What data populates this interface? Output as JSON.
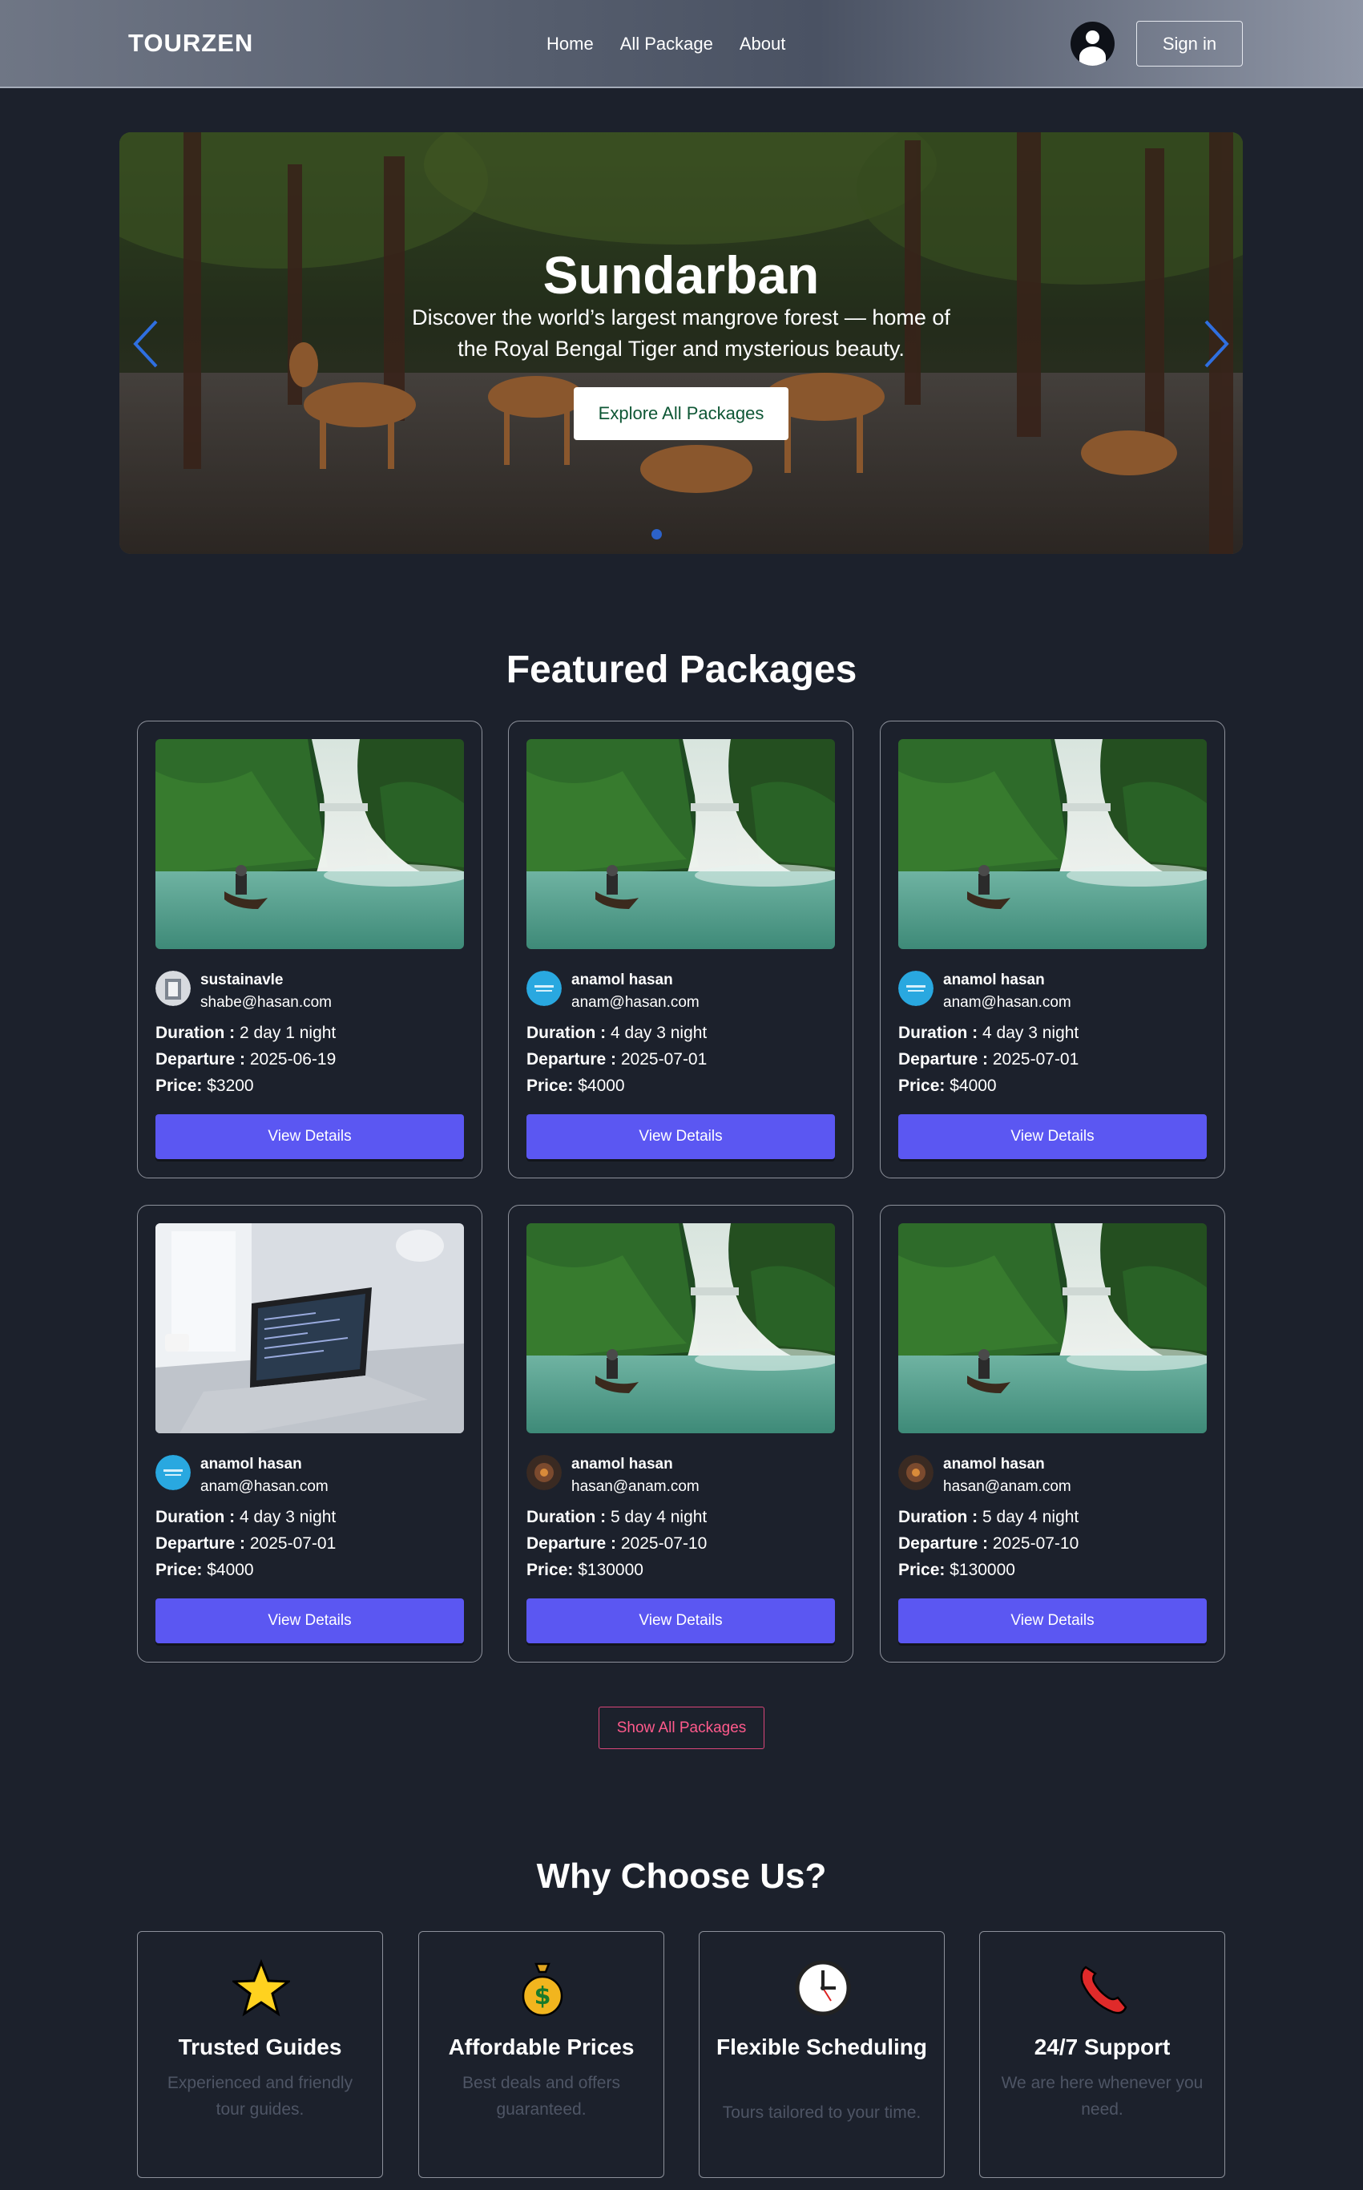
{
  "navbar": {
    "logo": "TOURZEN",
    "links": [
      "Home",
      "All Package",
      "About"
    ],
    "signin_label": "Sign in"
  },
  "hero": {
    "title": "Sundarban",
    "description": "Discover the world’s largest mangrove forest — home of the Royal Bengal Tiger and mysterious beauty.",
    "button_label": "Explore All Packages"
  },
  "featured": {
    "title": "Featured Packages",
    "labels": {
      "duration": "Duration :",
      "departure": "Departure :",
      "price": "Price:"
    },
    "button_label": "View Details",
    "packages": [
      {
        "name": "sustainavle",
        "email": "shabe@hasan.com",
        "duration": "2 day 1 night",
        "departure": "2025-06-19",
        "price": "$3200",
        "image": "waterfall",
        "avatar": "gray"
      },
      {
        "name": "anamol hasan",
        "email": "anam@hasan.com",
        "duration": "4 day 3 night",
        "departure": "2025-07-01",
        "price": "$4000",
        "image": "waterfall",
        "avatar": "blue"
      },
      {
        "name": "anamol hasan",
        "email": "anam@hasan.com",
        "duration": "4 day 3 night",
        "departure": "2025-07-01",
        "price": "$4000",
        "image": "waterfall",
        "avatar": "blue"
      },
      {
        "name": "anamol hasan",
        "email": "anam@hasan.com",
        "duration": "4 day 3 night",
        "departure": "2025-07-01",
        "price": "$4000",
        "image": "laptop",
        "avatar": "blue"
      },
      {
        "name": "anamol hasan",
        "email": "hasan@anam.com",
        "duration": "5 day 4 night",
        "departure": "2025-07-10",
        "price": "$130000",
        "image": "waterfall",
        "avatar": "dark"
      },
      {
        "name": "anamol hasan",
        "email": "hasan@anam.com",
        "duration": "5 day 4 night",
        "departure": "2025-07-10",
        "price": "$130000",
        "image": "waterfall",
        "avatar": "dark"
      }
    ],
    "show_all_label": "Show All Packages"
  },
  "why": {
    "title": "Why Choose Us?",
    "features": [
      {
        "icon": "star-icon",
        "title": "Trusted Guides",
        "desc": "Experienced and friendly tour guides."
      },
      {
        "icon": "money-bag-icon",
        "title": "Affordable Prices",
        "desc": "Best deals and offers guaranteed."
      },
      {
        "icon": "clock-icon",
        "title": "Flexible Scheduling",
        "desc": "Tours tailored to your time."
      },
      {
        "icon": "phone-icon",
        "title": "24/7 Support",
        "desc": "We are here whenever you need."
      }
    ]
  },
  "colors": {
    "background": "#1c212c",
    "button_primary": "#5b57f2",
    "accent_pink": "#ff5a8c",
    "hero_button_text": "#0d5634"
  }
}
